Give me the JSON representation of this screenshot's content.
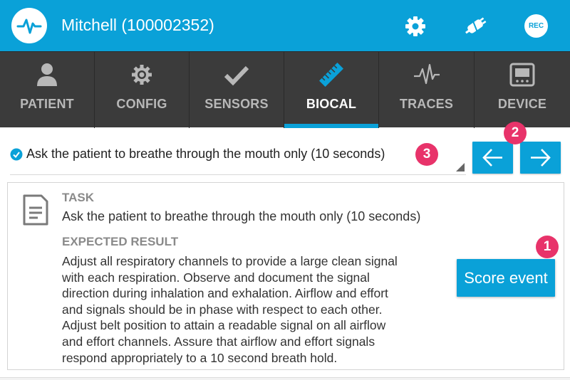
{
  "header": {
    "title": "Mitchell (100002352)",
    "logo_icon": "pulse-logo-icon",
    "rec_label": "REC",
    "icons": [
      "gear-icon",
      "plug-icon",
      "rec-icon"
    ],
    "color": "#0aa1d8"
  },
  "tabs": [
    {
      "label": "PATIENT",
      "icon": "person-icon",
      "active": false
    },
    {
      "label": "CONFIG",
      "icon": "gear-icon",
      "active": false
    },
    {
      "label": "SENSORS",
      "icon": "checkmark-icon",
      "active": false
    },
    {
      "label": "BIOCAL",
      "icon": "ruler-icon",
      "active": true
    },
    {
      "label": "TRACES",
      "icon": "waveform-icon",
      "active": false
    },
    {
      "label": "DEVICE",
      "icon": "monitor-icon",
      "active": false
    }
  ],
  "step": {
    "selected": "Ask the patient to breathe through the mouth only (10 seconds)",
    "status_icon": "check-circle-icon"
  },
  "nav": {
    "prev_icon": "arrow-left-icon",
    "next_icon": "arrow-right-icon"
  },
  "badges": {
    "one": "1",
    "two": "2",
    "three": "3",
    "color": "#e8336a"
  },
  "task": {
    "label": "TASK",
    "text": "Ask the patient to breathe through the mouth only (10 seconds)",
    "expected_label": "EXPECTED RESULT",
    "expected_lines": [
      "Adjust all respiratory channels to provide a large clean signal",
      "with each respiration. Observe and document the signal",
      "direction during inhalation and exhalation. Airflow and effort",
      "and signals should be in phase with respect to each other.",
      "Adjust belt position to attain a readable signal on all airflow",
      "and effort channels. Assure that airflow and effort signals",
      "respond appropriately to a 10 second breath hold."
    ],
    "score_label": "Score event"
  }
}
